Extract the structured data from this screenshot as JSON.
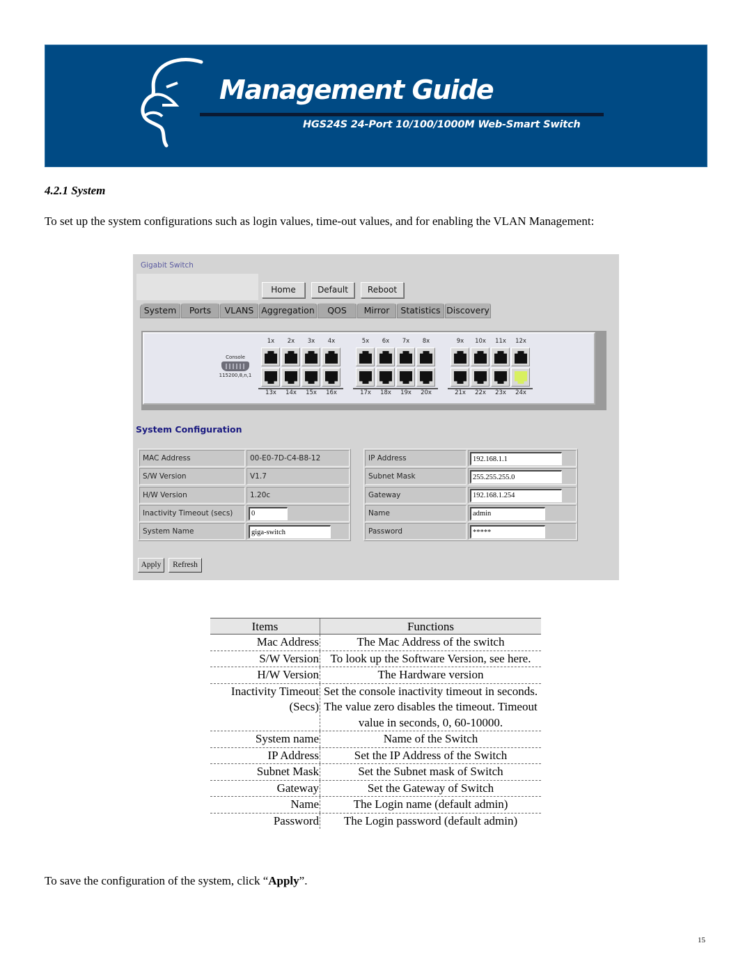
{
  "banner": {
    "title": "Management Guide",
    "subtitle": "HGS24S  24-Port 10/100/1000M Web-Smart Switch",
    "background": "#004a84"
  },
  "section": {
    "heading": "4.2.1 System",
    "intro": "To set up the system configurations such as login values, time-out values, and for enabling the VLAN Management:"
  },
  "ui": {
    "brand": "Gigabit Switch",
    "top_buttons": [
      "Home",
      "Default",
      "Reboot"
    ],
    "tabs": [
      "System",
      "Ports",
      "VLANS",
      "Aggregation",
      "QOS",
      "Mirror",
      "Statistics",
      "Discovery"
    ],
    "console": {
      "label": "Console",
      "settings": "115200,8,n,1"
    },
    "ports_top": [
      "1x",
      "2x",
      "3x",
      "4x",
      "5x",
      "6x",
      "7x",
      "8x",
      "9x",
      "10x",
      "11x",
      "12x"
    ],
    "ports_bottom": [
      "13x",
      "14x",
      "15x",
      "16x",
      "17x",
      "18x",
      "19x",
      "20x",
      "21x",
      "22x",
      "23x",
      "24x"
    ],
    "active_port": "24x",
    "active_port_color": "#d8f060",
    "config_title": "System Configuration",
    "left_fields": [
      {
        "label": "MAC Address",
        "value": "00-E0-7D-C4-B8-12",
        "editable": false
      },
      {
        "label": "S/W Version",
        "value": "V1.7",
        "editable": false
      },
      {
        "label": "H/W Version",
        "value": "1.20c",
        "editable": false
      },
      {
        "label": "Inactivity Timeout (secs)",
        "value": "0",
        "editable": true
      },
      {
        "label": "System Name",
        "value": "giga-switch",
        "editable": true
      }
    ],
    "right_fields": [
      {
        "label": "IP Address",
        "value": "192.168.1.1"
      },
      {
        "label": "Subnet Mask",
        "value": "255.255.255.0"
      },
      {
        "label": "Gateway",
        "value": "192.168.1.254"
      },
      {
        "label": "Name",
        "value": "admin"
      },
      {
        "label": "Password",
        "value": "*****"
      }
    ],
    "apply_label": "Apply",
    "refresh_label": "Refresh"
  },
  "functions_table": {
    "headers": [
      "Items",
      "Functions"
    ],
    "rows": [
      {
        "item": "Mac Address",
        "function": "The Mac Address of the switch"
      },
      {
        "item": "S/W Version",
        "function": "To look up the Software Version, see here."
      },
      {
        "item": "H/W Version",
        "function": "The Hardware version"
      },
      {
        "item": "Inactivity Timeout (Secs)",
        "function": "Set the console inactivity timeout in seconds. The value zero disables the timeout.  Timeout value in seconds, 0, 60-10000."
      },
      {
        "item": "System name",
        "function": "Name of the Switch"
      },
      {
        "item": "IP Address",
        "function": "Set the IP Address of the Switch"
      },
      {
        "item": "Subnet Mask",
        "function": "Set the Subnet mask of Switch"
      },
      {
        "item": "Gateway",
        "function": "Set the Gateway of Switch"
      },
      {
        "item": "Name",
        "function": "The Login name (default admin)"
      },
      {
        "item": "Password",
        "function": "The Login password (default admin)"
      }
    ]
  },
  "footer": {
    "prefix": "To save the configuration of the system, click “",
    "bold": "Apply",
    "suffix": "”."
  },
  "page_number": "15"
}
